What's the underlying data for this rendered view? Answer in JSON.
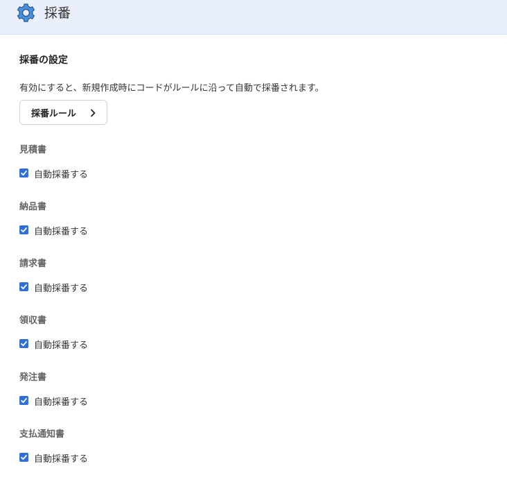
{
  "header": {
    "title": "採番",
    "icon": "gear-icon",
    "icon_color": "#4a8fd8"
  },
  "section": {
    "title": "採番の設定",
    "description": "有効にすると、新規作成時にコードがルールに沿って自動で採番されます。",
    "rule_button_label": "採番ルール",
    "rule_button_icon": "chevron-right-icon"
  },
  "groups": [
    {
      "label": "見積書",
      "checkbox_label": "自動採番する",
      "checked": true
    },
    {
      "label": "納品書",
      "checkbox_label": "自動採番する",
      "checked": true
    },
    {
      "label": "請求書",
      "checkbox_label": "自動採番する",
      "checked": true
    },
    {
      "label": "領収書",
      "checkbox_label": "自動採番する",
      "checked": true
    },
    {
      "label": "発注書",
      "checkbox_label": "自動採番する",
      "checked": true
    },
    {
      "label": "支払通知書",
      "checkbox_label": "自動採番する",
      "checked": true
    }
  ],
  "colors": {
    "header_bg": "#eaf0fb",
    "checkbox_checked": "#2f6fd6"
  }
}
